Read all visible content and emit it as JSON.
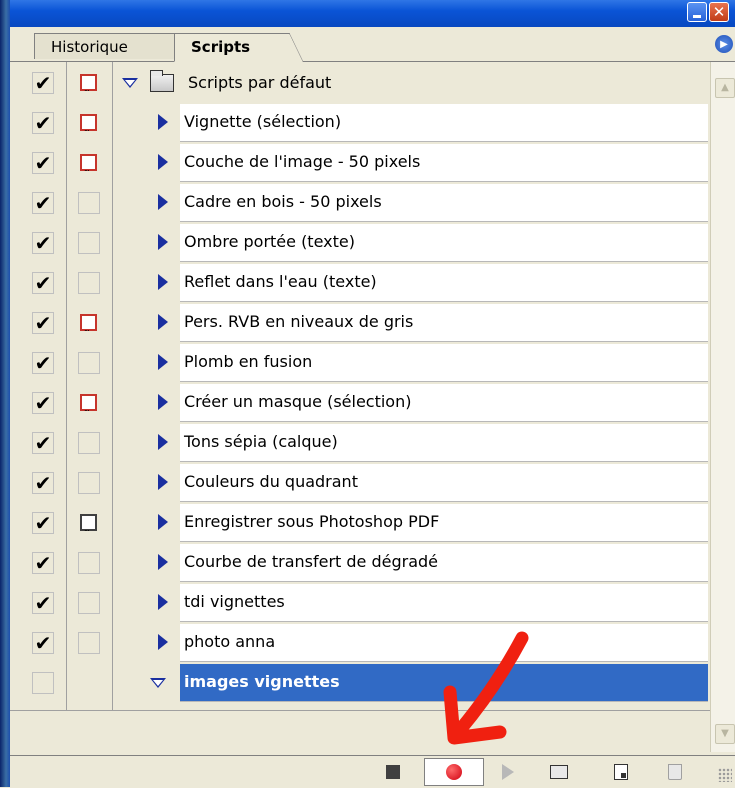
{
  "tabs": [
    {
      "label": "Historique"
    },
    {
      "label": "Scripts"
    }
  ],
  "set": {
    "label": "Scripts par défaut",
    "check": "✔"
  },
  "actions": [
    {
      "label": "Vignette (sélection)",
      "check": "✔",
      "dialog": "on"
    },
    {
      "label": "Couche de l'image - 50 pixels",
      "check": "✔",
      "dialog": "on"
    },
    {
      "label": "Cadre en bois - 50 pixels",
      "check": "✔",
      "dialog": "off"
    },
    {
      "label": "Ombre portée (texte)",
      "check": "✔",
      "dialog": "off"
    },
    {
      "label": "Reflet dans l'eau (texte)",
      "check": "✔",
      "dialog": "off"
    },
    {
      "label": "Pers. RVB en niveaux de gris",
      "check": "✔",
      "dialog": "on"
    },
    {
      "label": "Plomb en fusion",
      "check": "✔",
      "dialog": "off"
    },
    {
      "label": "Créer un masque (sélection)",
      "check": "✔",
      "dialog": "on"
    },
    {
      "label": "Tons sépia (calque)",
      "check": "✔",
      "dialog": "off"
    },
    {
      "label": "Couleurs du quadrant",
      "check": "✔",
      "dialog": "off"
    },
    {
      "label": "Enregistrer sous Photoshop PDF",
      "check": "✔",
      "dialog": "dark"
    },
    {
      "label": "Courbe de transfert de dégradé",
      "check": "✔",
      "dialog": "off"
    },
    {
      "label": "tdi vignettes",
      "check": "✔",
      "dialog": "off"
    },
    {
      "label": "photo anna",
      "check": "✔",
      "dialog": "off"
    }
  ],
  "selected_set": {
    "label": "images vignettes",
    "check": ""
  },
  "toolbar": [
    "stop-icon",
    "record-icon",
    "play-icon",
    "new-set-folder-icon",
    "new-action-icon",
    "trash-icon"
  ],
  "colors": {
    "selection": "#316ac5",
    "record": "#d00010",
    "annotation_arrow": "#f02010",
    "dialog_icon": "#c6342b"
  }
}
